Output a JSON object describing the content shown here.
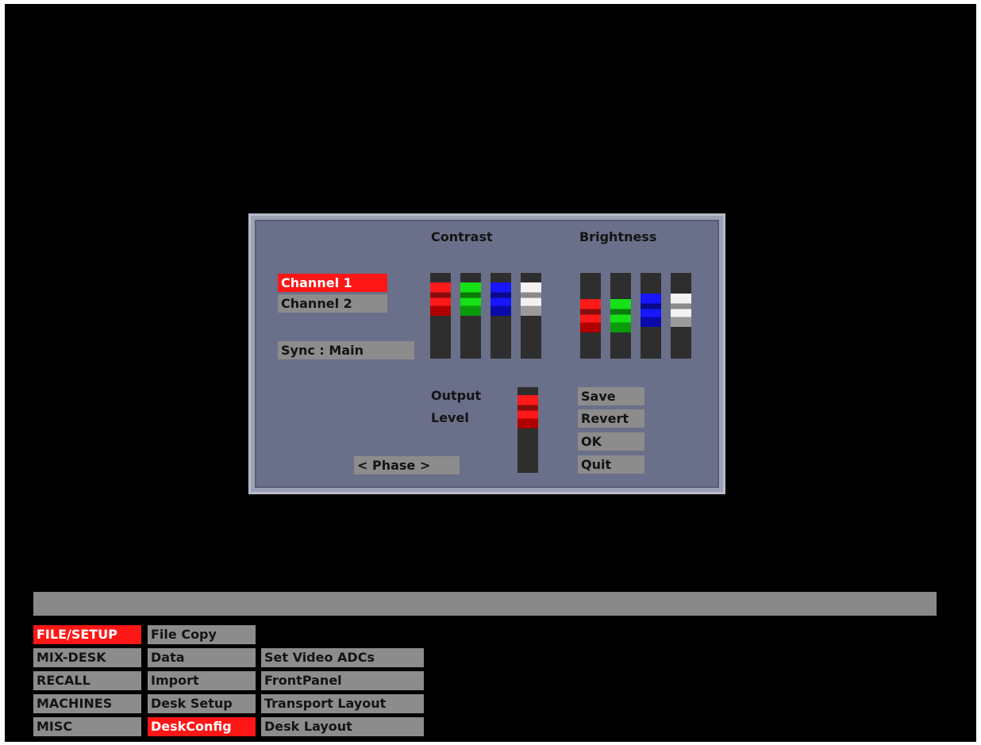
{
  "dialog": {
    "headings": {
      "contrast": "Contrast",
      "brightness": "Brightness"
    },
    "channels": [
      {
        "label": "Channel 1",
        "selected": true
      },
      {
        "label": "Channel 2",
        "selected": false
      }
    ],
    "sync_label": "Sync : Main",
    "phase_label": "< Phase >",
    "output_label_line1": "Output",
    "output_label_line2": "Level",
    "contrast_sliders": [
      {
        "color": "red",
        "level": 0.82
      },
      {
        "color": "green",
        "level": 0.82
      },
      {
        "color": "blue",
        "level": 0.82
      },
      {
        "color": "white",
        "level": 0.82
      }
    ],
    "brightness_sliders": [
      {
        "color": "red",
        "level": 0.5
      },
      {
        "color": "green",
        "level": 0.5
      },
      {
        "color": "blue",
        "level": 0.6
      },
      {
        "color": "white",
        "level": 0.6
      }
    ],
    "output_level": 0.85,
    "actions": {
      "save": "Save",
      "revert": "Revert",
      "ok": "OK",
      "quit": "Quit"
    }
  },
  "menu": {
    "col1": [
      {
        "label": "FILE/SETUP",
        "selected": true
      },
      {
        "label": "MIX-DESK",
        "selected": false
      },
      {
        "label": "RECALL",
        "selected": false
      },
      {
        "label": "MACHINES",
        "selected": false
      },
      {
        "label": "MISC",
        "selected": false
      }
    ],
    "col2": [
      {
        "label": "File  Copy",
        "selected": false
      },
      {
        "label": "Data",
        "selected": false
      },
      {
        "label": "Import",
        "selected": false
      },
      {
        "label": "Desk Setup",
        "selected": false
      },
      {
        "label": "DeskConfig",
        "selected": true
      }
    ],
    "col3": [
      {
        "label": "Set  Video  ADCs",
        "selected": false
      },
      {
        "label": "FrontPanel",
        "selected": false
      },
      {
        "label": "Transport  Layout",
        "selected": false
      },
      {
        "label": "Desk  Layout",
        "selected": false
      }
    ]
  },
  "colors": {
    "selected": "#ff1616",
    "panel": "#6a6f8a",
    "button": "#8c8c8c"
  }
}
